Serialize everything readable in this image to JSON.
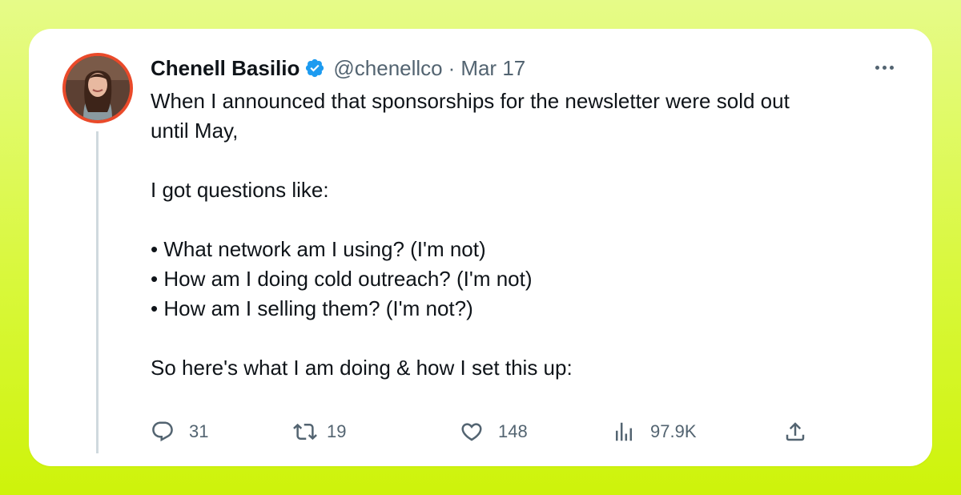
{
  "tweet": {
    "author_name": "Chenell Basilio",
    "handle": "@chenellco",
    "separator": "·",
    "date": "Mar 17",
    "lines": [
      "When I announced that sponsorships for the newsletter were sold out",
      "until May,",
      "",
      "I got questions like:",
      "",
      "• What network am I using? (I'm not)",
      "• How am I doing cold outreach? (I'm not)",
      "• How am I selling them? (I'm not?)",
      "",
      "So here's what I am doing & how I set this up:"
    ]
  },
  "actions": {
    "replies": "31",
    "retweets": "19",
    "likes": "148",
    "views": "97.9K"
  },
  "icons": {
    "verified": "verified-badge-icon",
    "more": "more-options-icon",
    "reply": "reply-icon",
    "retweet": "retweet-icon",
    "like": "heart-icon",
    "views": "views-chart-icon",
    "share": "share-icon"
  },
  "colors": {
    "background_top": "#e6fb88",
    "background_bottom": "#cef30a",
    "verified_blue": "#1d9bf0",
    "avatar_ring": "#ea4a2a",
    "text_primary": "#0f1419",
    "text_secondary": "#536471"
  }
}
